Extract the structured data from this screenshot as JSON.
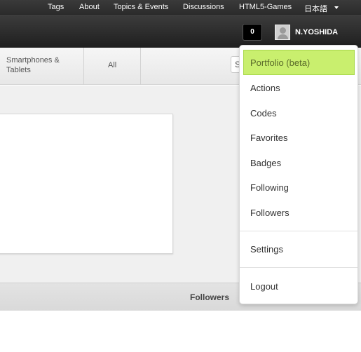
{
  "topnav": {
    "links": [
      "Tags",
      "About",
      "Topics & Events",
      "Discussions",
      "HTML5-Games",
      "日本語"
    ]
  },
  "userbar": {
    "notification_count": "0",
    "username": "N.YOSHIDA"
  },
  "categories": {
    "items": [
      "Smartphones &",
      "Tablets",
      "All"
    ],
    "search_value": "S"
  },
  "footer": {
    "label": "Followers"
  },
  "dropdown": {
    "items": [
      "Portfolio (beta)",
      "Actions",
      "Codes",
      "Favorites",
      "Badges",
      "Following",
      "Followers",
      "Settings",
      "Logout"
    ],
    "highlight_color": "#c9ef6e"
  }
}
